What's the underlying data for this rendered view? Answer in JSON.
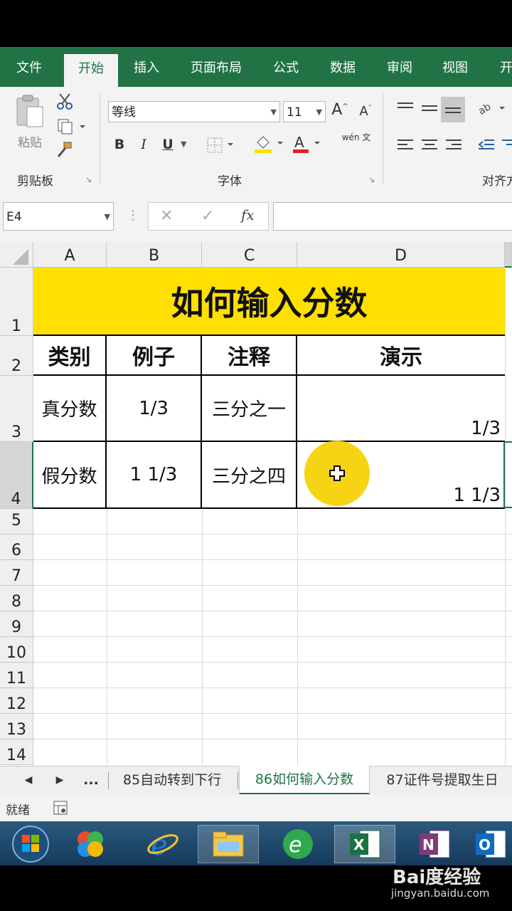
{
  "ribbon_tabs": [
    "文件",
    "开始",
    "插入",
    "页面布局",
    "公式",
    "数据",
    "审阅",
    "视图",
    "开"
  ],
  "ribbon": {
    "paste_label": "粘贴",
    "clipboard_group": "剪贴板",
    "font_name": "等线",
    "font_size": "11",
    "font_group": "字体",
    "align_group": "对齐方",
    "bold": "B",
    "italic": "I",
    "underline": "U",
    "phonetic": "wén 文"
  },
  "formula_bar": {
    "name_box": "E4",
    "fx": "fx",
    "formula": ""
  },
  "columns": [
    "A",
    "B",
    "C",
    "D"
  ],
  "rows": [
    "1",
    "2",
    "3",
    "4",
    "5",
    "6",
    "7",
    "8",
    "9",
    "10",
    "11",
    "12",
    "13",
    "14"
  ],
  "table": {
    "title": "如何输入分数",
    "headers": [
      "类别",
      "例子",
      "注释",
      "演示"
    ],
    "row3": [
      "真分数",
      "1/3",
      "三分之一",
      "1/3"
    ],
    "row4": [
      "假分数",
      "1 1/3",
      "三分之四",
      "1 1/3"
    ]
  },
  "sheet_tabs": {
    "ellipsis": "...",
    "tabs": [
      "85自动转到下行",
      "86如何输入分数",
      "87证件号提取生日"
    ],
    "active_index": 1
  },
  "status": {
    "text": "就绪"
  },
  "colors": {
    "excel_green": "#217346",
    "title_fill": "#ffe000",
    "cursor_highlight": "#f5d000"
  },
  "taskbar": {
    "icons": [
      "windows-start-icon",
      "media-center-icon",
      "internet-explorer-icon",
      "file-explorer-icon",
      "ie-refresh-icon",
      "excel-icon",
      "onenote-icon",
      "outlook-icon"
    ]
  },
  "watermark": {
    "brand": "Bai度经验",
    "url": "jingyan.baidu.com"
  }
}
